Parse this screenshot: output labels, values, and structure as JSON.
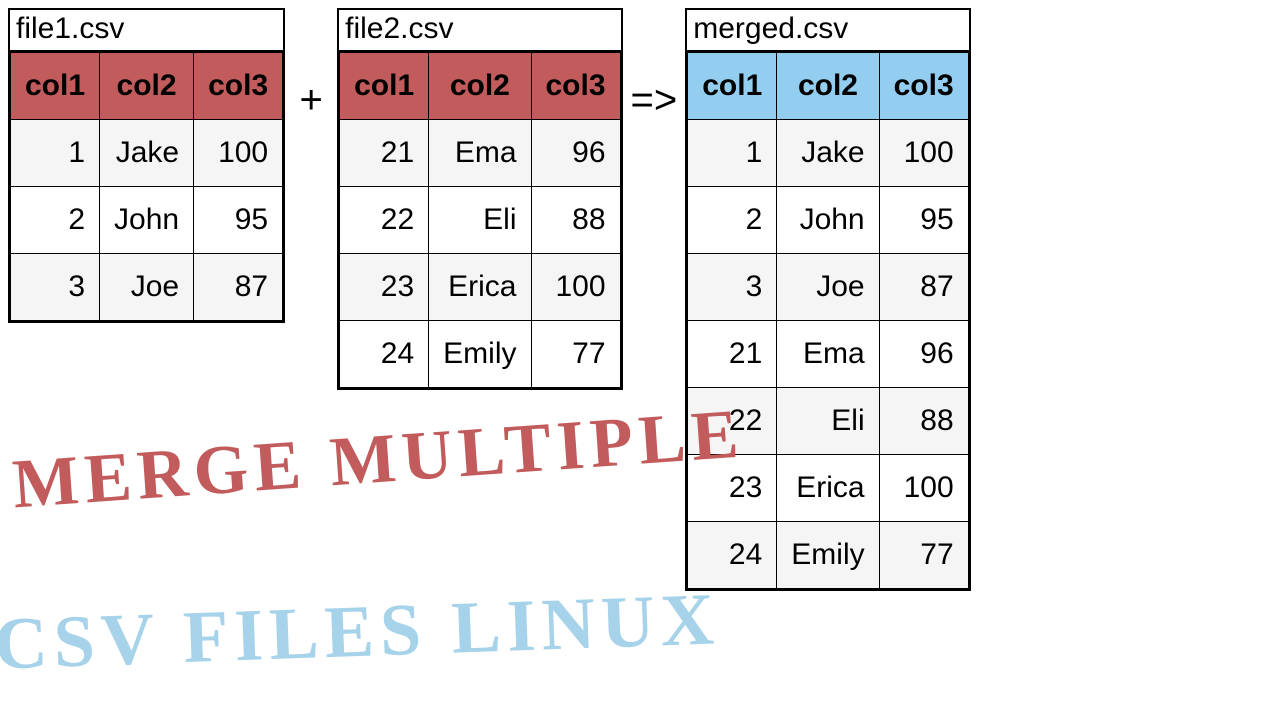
{
  "op_plus": "+",
  "op_arrow": "=>",
  "table1": {
    "title": "file1.csv",
    "headers": [
      "col1",
      "col2",
      "col3"
    ],
    "rows": [
      [
        "1",
        "Jake",
        "100"
      ],
      [
        "2",
        "John",
        "95"
      ],
      [
        "3",
        "Joe",
        "87"
      ]
    ]
  },
  "table2": {
    "title": "file2.csv",
    "headers": [
      "col1",
      "col2",
      "col3"
    ],
    "rows": [
      [
        "21",
        "Ema",
        "96"
      ],
      [
        "22",
        "Eli",
        "88"
      ],
      [
        "23",
        "Erica",
        "100"
      ],
      [
        "24",
        "Emily",
        "77"
      ]
    ]
  },
  "table3": {
    "title": "merged.csv",
    "headers": [
      "col1",
      "col2",
      "col3"
    ],
    "rows": [
      [
        "1",
        "Jake",
        "100"
      ],
      [
        "2",
        "John",
        "95"
      ],
      [
        "3",
        "Joe",
        "87"
      ],
      [
        "21",
        "Ema",
        "96"
      ],
      [
        "22",
        "Eli",
        "88"
      ],
      [
        "23",
        "Erica",
        "100"
      ],
      [
        "24",
        "Emily",
        "77"
      ]
    ]
  },
  "overlay": {
    "line1": "MERGE MULTIPLE",
    "line2": "CSV FILES LINUX"
  }
}
